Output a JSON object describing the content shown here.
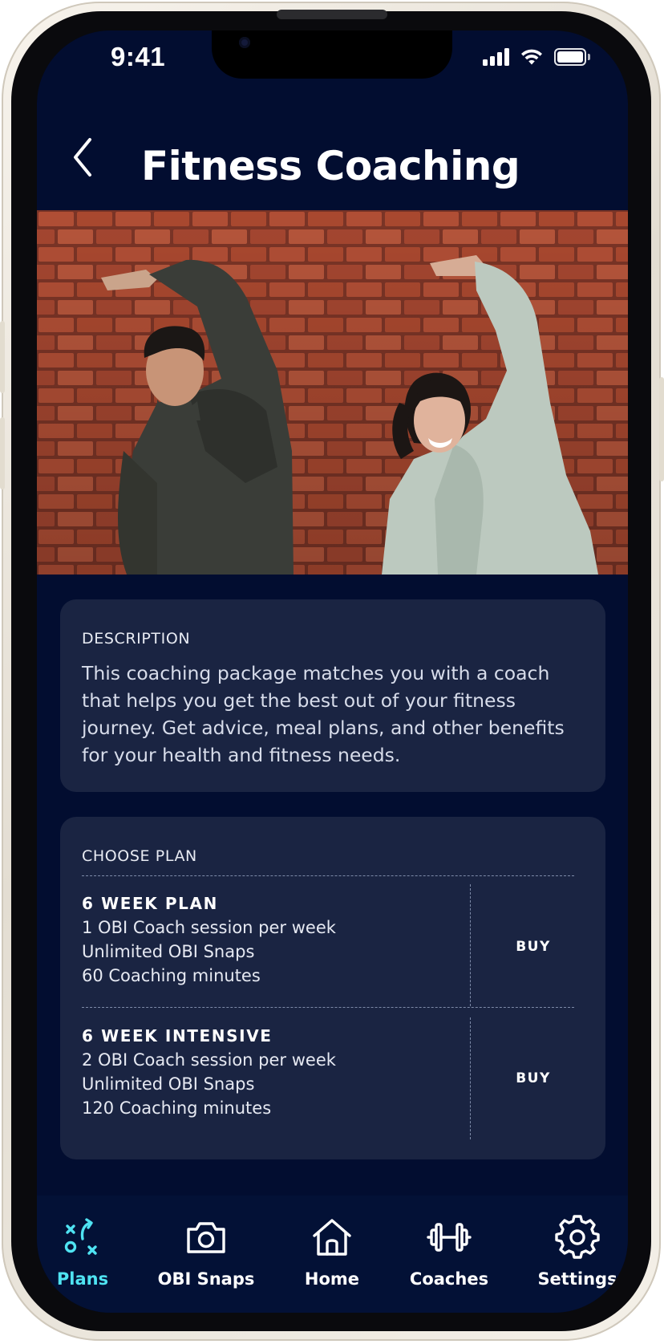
{
  "status_bar": {
    "time": "9:41"
  },
  "header": {
    "title": "Fitness Coaching"
  },
  "description": {
    "label": "DESCRIPTION",
    "text": "This coaching package matches you with a coach that helps you get the best out of your fitness journey. Get advice, meal plans, and other benefits for your health and fitness needs."
  },
  "plans": {
    "label": "CHOOSE PLAN",
    "items": [
      {
        "title": "6 WEEK PLAN",
        "features": [
          "1 OBI Coach session per week",
          "Unlimited OBI Snaps",
          "60 Coaching minutes"
        ],
        "buy_label": "BUY"
      },
      {
        "title": "6 WEEK INTENSIVE",
        "features": [
          "2 OBI Coach session per week",
          "Unlimited OBI Snaps",
          "120 Coaching minutes"
        ],
        "buy_label": "BUY"
      }
    ]
  },
  "tabbar": {
    "active_color": "#4fe3f2",
    "items": [
      {
        "label": "Plans",
        "icon": "plans-strategy-icon",
        "active": true
      },
      {
        "label": "OBI Snaps",
        "icon": "camera-icon",
        "active": false
      },
      {
        "label": "Home",
        "icon": "home-icon",
        "active": false
      },
      {
        "label": "Coaches",
        "icon": "dumbbell-icon",
        "active": false
      },
      {
        "label": "Settings",
        "icon": "gear-icon",
        "active": false
      }
    ]
  },
  "colors": {
    "background": "#020d30",
    "card": "#1a2442",
    "accent": "#4fe3f2"
  }
}
